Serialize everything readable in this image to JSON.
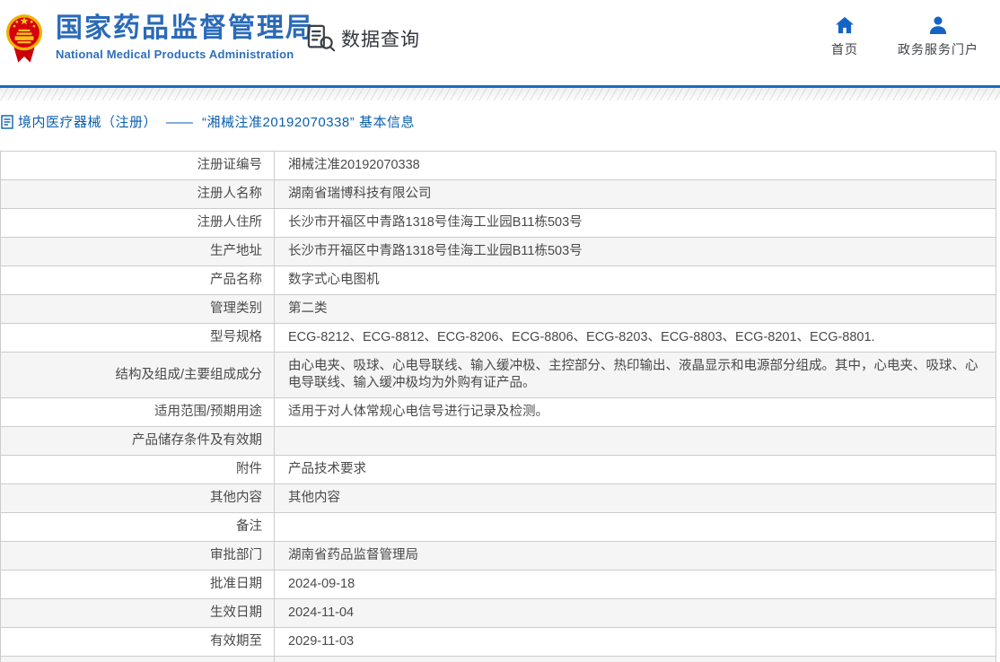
{
  "colors": {
    "accent_blue": "#2a6ab8",
    "icon_blue": "#1464c8",
    "bar_blue": "#1b6bc0",
    "link_blue": "#0b5fae",
    "row_alt_bg": "#f5f5f6",
    "border": "#cccccc",
    "text": "#4a4a4a"
  },
  "header": {
    "logo_icon": "national-emblem",
    "site_title": "国家药品监督管理局",
    "site_subtitle": "National Medical Products Administration",
    "data_query": {
      "icon": "document-search-icon",
      "label": "数据查询"
    },
    "nav": [
      {
        "icon": "home-icon",
        "label": "首页"
      },
      {
        "icon": "user-icon",
        "label": "政务服务门户"
      }
    ]
  },
  "breadcrumb": {
    "icon": "document-icon",
    "category": "境内医疗器械（注册）",
    "separator": "——",
    "detail": "“湘械注准20192070338” 基本信息"
  },
  "table": {
    "rows": [
      {
        "label": "注册证编号",
        "value": "湘械注准20192070338"
      },
      {
        "label": "注册人名称",
        "value": "湖南省瑞博科技有限公司"
      },
      {
        "label": "注册人住所",
        "value": "长沙市开福区中青路1318号佳海工业园B11栋503号"
      },
      {
        "label": "生产地址",
        "value": "长沙市开福区中青路1318号佳海工业园B11栋503号"
      },
      {
        "label": "产品名称",
        "value": "数字式心电图机"
      },
      {
        "label": "管理类别",
        "value": "第二类"
      },
      {
        "label": "型号规格",
        "value": "ECG-8212、ECG-8812、ECG-8206、ECG-8806、ECG-8203、ECG-8803、ECG-8201、ECG-8801."
      },
      {
        "label": "结构及组成/主要组成成分",
        "value": "由心电夹、吸球、心电导联线、输入缓冲极、主控部分、热印输出、液晶显示和电源部分组成。其中，心电夹、吸球、心电导联线、输入缓冲极均为外购有证产品。"
      },
      {
        "label": "适用范围/预期用途",
        "value": "适用于对人体常规心电信号进行记录及检测。"
      },
      {
        "label": "产品储存条件及有效期",
        "value": ""
      },
      {
        "label": "附件",
        "value": "产品技术要求"
      },
      {
        "label": "其他内容",
        "value": "其他内容"
      },
      {
        "label": "备注",
        "value": ""
      },
      {
        "label": "审批部门",
        "value": "湖南省药品监督管理局"
      },
      {
        "label": "批准日期",
        "value": "2024-09-18"
      },
      {
        "label": "生效日期",
        "value": "2024-11-04"
      },
      {
        "label": "有效期至",
        "value": "2029-11-03"
      },
      {
        "label": "",
        "value": ""
      }
    ]
  }
}
